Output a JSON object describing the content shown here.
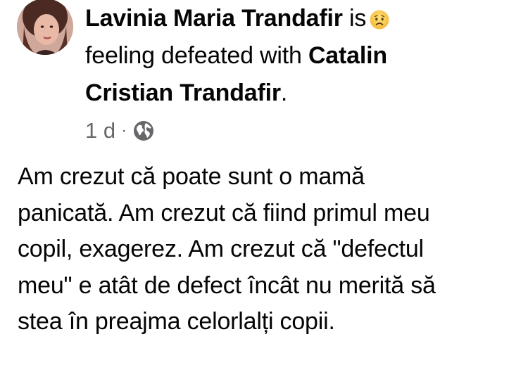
{
  "post": {
    "author": "Lavinia Maria Trandafir",
    "is_word": "is",
    "feeling_text": "feeling defeated with",
    "tagged": "Catalin Cristian Trandafir",
    "tagged_line1": "Catalin",
    "tagged_line2": "Cristian Trandafir",
    "period": ".",
    "feeling_icon": "sad-face-emoji",
    "time": "1 d",
    "separator": "·",
    "privacy_icon": "globe-icon",
    "text_lines": [
      "Am crezut că poate sunt o mamă",
      "panicată. Am crezut că fiind primul meu",
      "copil, exagerez. Am crezut că \"defectul",
      "meu\" e atât de defect încât nu merită să",
      "stea în preajma celorlalți copii."
    ]
  }
}
